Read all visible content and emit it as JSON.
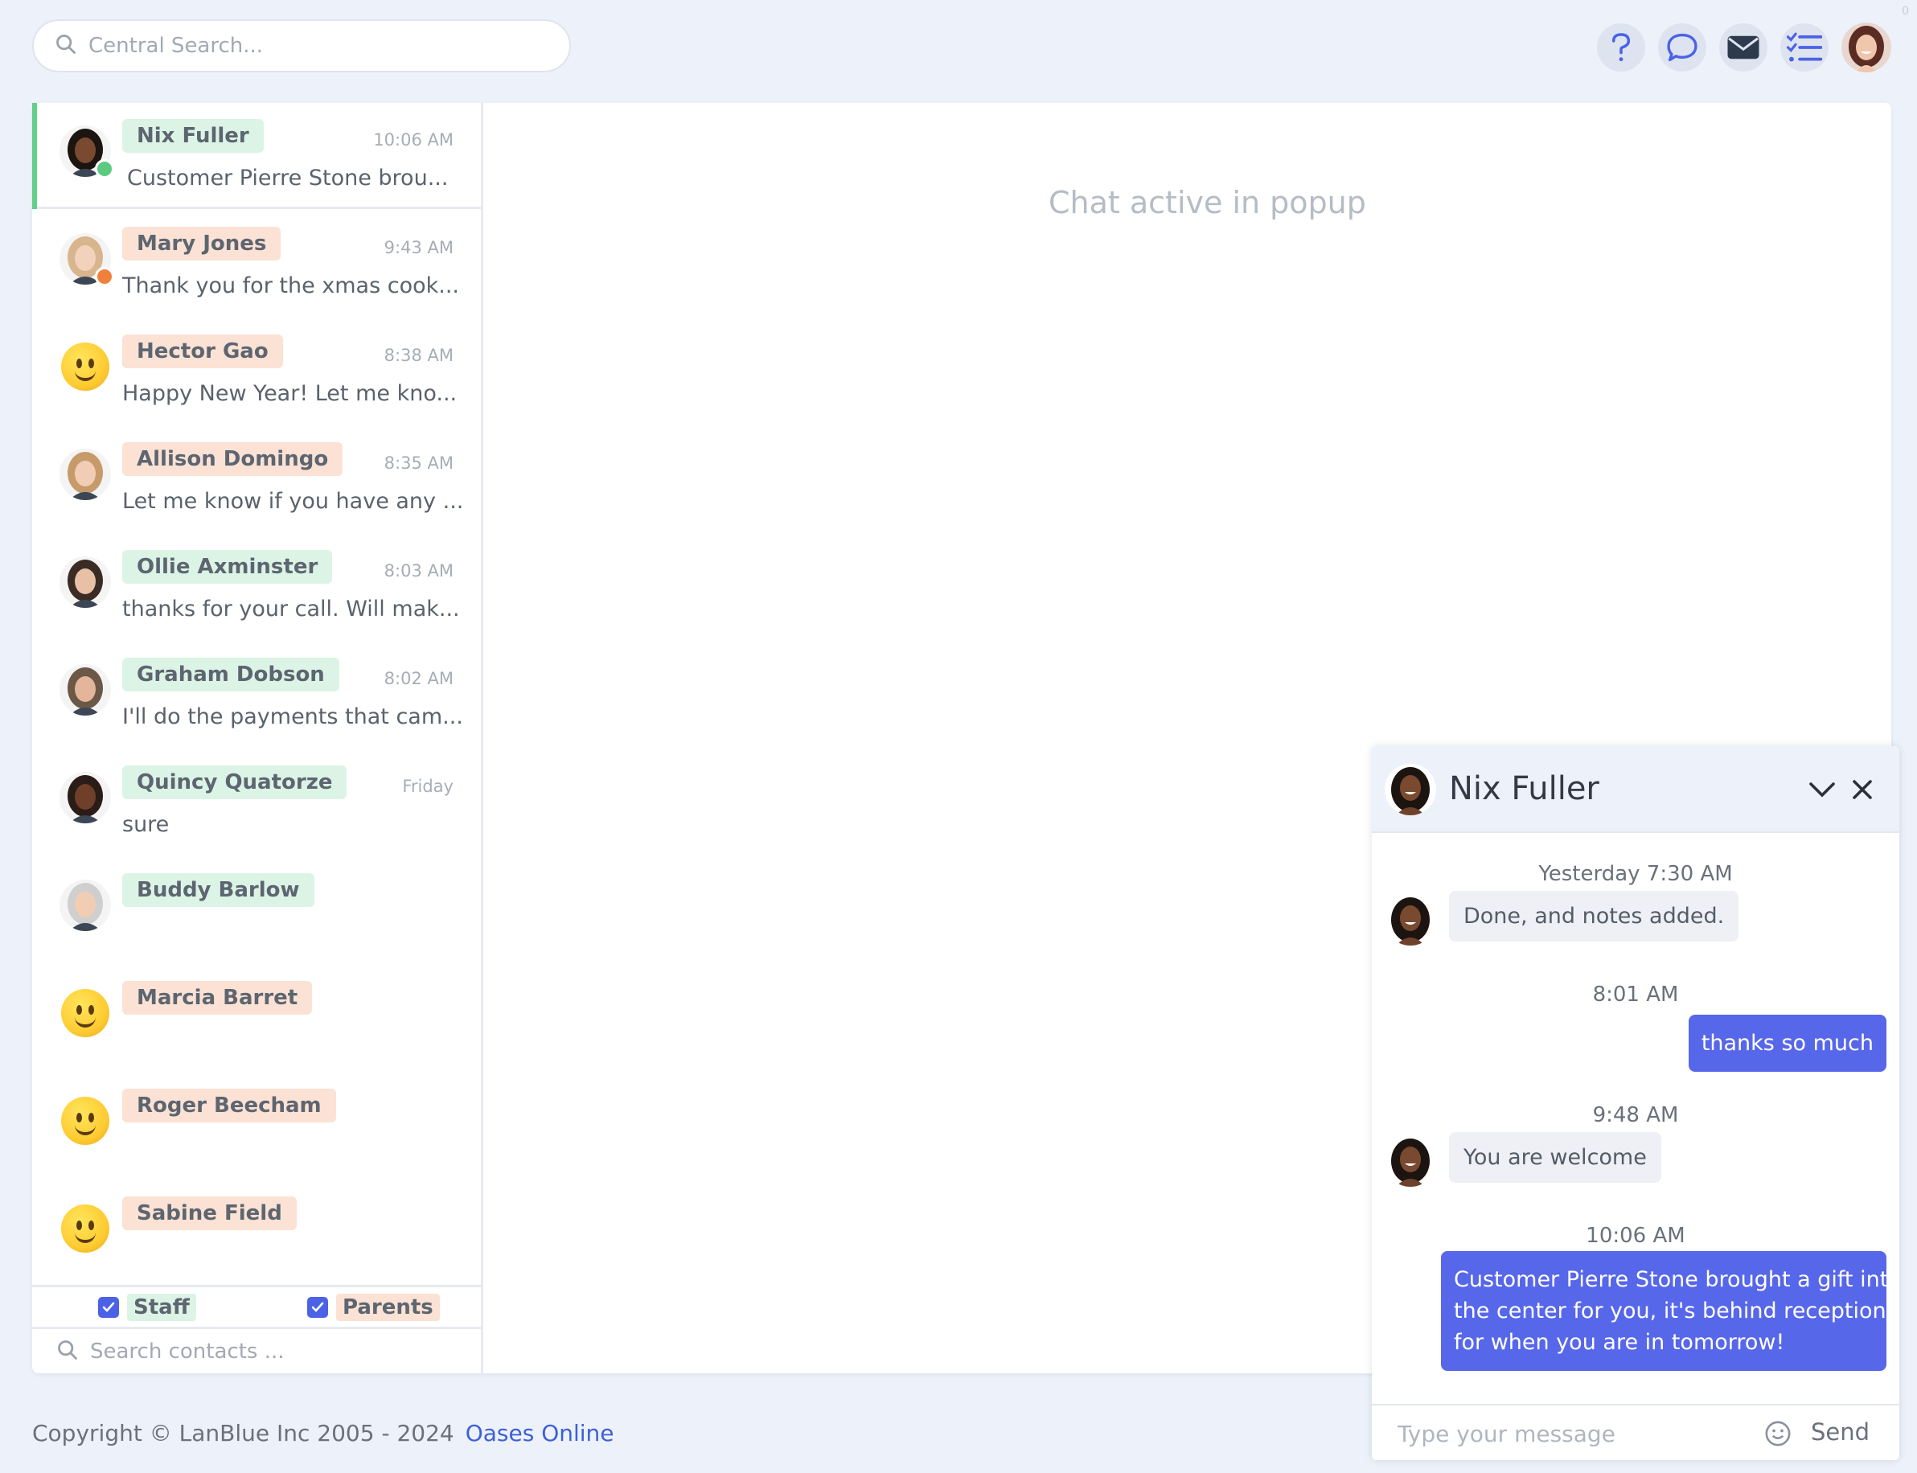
{
  "search": {
    "placeholder": "Central Search..."
  },
  "header": {
    "icons": [
      "help-icon",
      "chat-bubble-icon",
      "envelope-icon",
      "checklist-icon"
    ],
    "corner_count": "0"
  },
  "contacts": [
    {
      "name": "Nix Fuller",
      "time": "10:06 AM",
      "preview": "Customer Pierre Stone brou...",
      "tag": "green",
      "status": "#5ccb7f",
      "avatar": "photo"
    },
    {
      "name": "Mary Jones",
      "time": "9:43 AM",
      "preview": "Thank you for the xmas cook...",
      "tag": "orange",
      "status": "#f0813c",
      "avatar": "photo"
    },
    {
      "name": "Hector Gao",
      "time": "8:38 AM",
      "preview": "Happy New Year! Let me kno...",
      "tag": "orange",
      "avatar": "emoji"
    },
    {
      "name": "Allison Domingo",
      "time": "8:35 AM",
      "preview": "Let me know if you have any ...",
      "tag": "orange",
      "avatar": "photo"
    },
    {
      "name": "Ollie Axminster",
      "time": "8:03 AM",
      "preview": "thanks for your call. Will mak...",
      "tag": "green",
      "avatar": "photo"
    },
    {
      "name": "Graham Dobson",
      "time": "8:02 AM",
      "preview": "I'll do the payments that cam...",
      "tag": "green",
      "avatar": "photo"
    },
    {
      "name": "Quincy Quatorze",
      "time": "Friday",
      "preview": "sure",
      "tag": "green",
      "avatar": "photo"
    },
    {
      "name": "Buddy Barlow",
      "time": "",
      "preview": "",
      "tag": "green",
      "avatar": "photo"
    },
    {
      "name": "Marcia Barret",
      "time": "",
      "preview": "",
      "tag": "orange",
      "avatar": "emoji"
    },
    {
      "name": "Roger Beecham",
      "time": "",
      "preview": "",
      "tag": "orange",
      "avatar": "emoji"
    },
    {
      "name": "Sabine Field",
      "time": "",
      "preview": "",
      "tag": "orange",
      "avatar": "emoji"
    }
  ],
  "filters": {
    "staff": "Staff",
    "parents": "Parents"
  },
  "contact_search": {
    "placeholder": "Search contacts ..."
  },
  "main": {
    "chat_active": "Chat active in popup"
  },
  "footer": {
    "copyright": "Copyright © LanBlue Inc  2005 - 2024",
    "link": "Oases Online"
  },
  "popup": {
    "title": "Nix Fuller",
    "messages": [
      {
        "time": "Yesterday 7:30 AM",
        "direction": "in",
        "text": "Done, and notes added."
      },
      {
        "time": "8:01 AM",
        "direction": "out",
        "text": "thanks so much"
      },
      {
        "time": "9:48 AM",
        "direction": "in",
        "text": "You are welcome"
      },
      {
        "time": "10:06 AM",
        "direction": "out",
        "lines": [
          "Customer Pierre Stone brought a gift into",
          "the center for you, it's behind reception",
          "for when you are in tomorrow!"
        ]
      }
    ],
    "composer_placeholder": "Type your message",
    "send": "Send"
  },
  "colors": {
    "accent": "#5767ea",
    "online": "#5ccb7f",
    "away": "#f0813c",
    "tag_green": "#dcf4e6",
    "tag_orange": "#fbe2d4"
  }
}
